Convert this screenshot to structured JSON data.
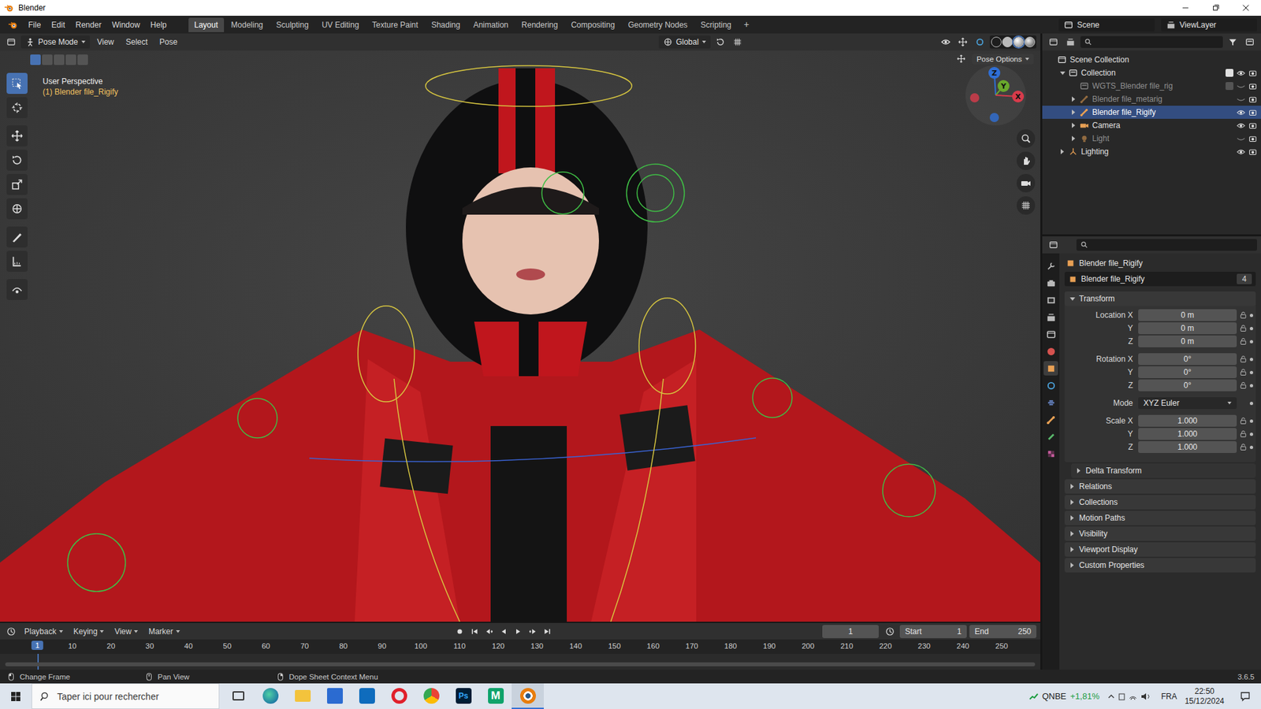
{
  "window": {
    "title": "Blender"
  },
  "menu": [
    "File",
    "Edit",
    "Render",
    "Window",
    "Help"
  ],
  "workspaces": [
    {
      "label": "Layout",
      "selected": true
    },
    {
      "label": "Modeling",
      "selected": false
    },
    {
      "label": "Sculpting",
      "selected": false
    },
    {
      "label": "UV Editing",
      "selected": false
    },
    {
      "label": "Texture Paint",
      "selected": false
    },
    {
      "label": "Shading",
      "selected": false
    },
    {
      "label": "Animation",
      "selected": false
    },
    {
      "label": "Rendering",
      "selected": false
    },
    {
      "label": "Compositing",
      "selected": false
    },
    {
      "label": "Geometry Nodes",
      "selected": false
    },
    {
      "label": "Scripting",
      "selected": false
    }
  ],
  "add_workspace": "+",
  "scene": "Scene",
  "view_layer": "ViewLayer",
  "viewport": {
    "mode": "Pose Mode",
    "menus": [
      "View",
      "Select",
      "Pose"
    ],
    "orientation": "Global",
    "pose_options": "Pose Options",
    "view_name": "User Perspective",
    "active_object": "(1) Blender file_Rigify",
    "select_modes": [
      {
        "selected": true
      },
      {
        "selected": false
      },
      {
        "selected": false
      },
      {
        "selected": false
      },
      {
        "selected": false
      }
    ],
    "tools": [
      {
        "kind": "select-box",
        "selected": true
      },
      {
        "kind": "cursor",
        "selected": false
      },
      {
        "kind": "move",
        "selected": false
      },
      {
        "kind": "rotate",
        "selected": false
      },
      {
        "kind": "scale",
        "selected": false
      },
      {
        "kind": "transform",
        "selected": false
      },
      {
        "kind": "annotate",
        "selected": false
      },
      {
        "kind": "measure",
        "selected": false
      },
      {
        "kind": "roll",
        "selected": false
      }
    ],
    "axes": [
      {
        "label": "Z",
        "color": "#2f6fd6"
      },
      {
        "label": "Y",
        "color": "#6aa82c"
      },
      {
        "label": "X",
        "color": "#d83b4b"
      }
    ],
    "nav": [
      {
        "kind": "zoom"
      },
      {
        "kind": "pan"
      },
      {
        "kind": "camera"
      },
      {
        "kind": "grid"
      }
    ]
  },
  "outliner": {
    "items": [
      {
        "label": "Scene Collection",
        "kind": "scene",
        "depth": 0,
        "expander": "none",
        "selected": false,
        "greyed": false,
        "has_checkbox": false,
        "checked": false,
        "visible": true,
        "has_eye": false
      },
      {
        "label": "Collection",
        "kind": "collection",
        "depth": 1,
        "expander": "open",
        "selected": false,
        "greyed": false,
        "has_checkbox": true,
        "checked": true,
        "visible": true,
        "has_eye": true
      },
      {
        "label": "WGTS_Blender file_rig",
        "kind": "collection",
        "depth": 2,
        "expander": "none",
        "selected": false,
        "greyed": true,
        "has_checkbox": true,
        "checked": false,
        "visible": false,
        "has_eye": true
      },
      {
        "label": "Blender file_metarig",
        "kind": "armature",
        "depth": 2,
        "expander": "closed",
        "selected": false,
        "greyed": true,
        "has_checkbox": false,
        "checked": false,
        "visible": false,
        "has_eye": true
      },
      {
        "label": "Blender file_Rigify",
        "kind": "armature",
        "depth": 2,
        "expander": "closed",
        "selected": true,
        "greyed": false,
        "has_checkbox": false,
        "checked": false,
        "visible": true,
        "has_eye": true
      },
      {
        "label": "Camera",
        "kind": "camera",
        "depth": 2,
        "expander": "closed",
        "selected": false,
        "greyed": false,
        "has_checkbox": false,
        "checked": false,
        "visible": true,
        "has_eye": true
      },
      {
        "label": "Light",
        "kind": "light",
        "depth": 2,
        "expander": "closed",
        "selected": false,
        "greyed": true,
        "has_checkbox": false,
        "checked": false,
        "visible": false,
        "has_eye": true
      },
      {
        "label": "Lighting",
        "kind": "lighting",
        "depth": 1,
        "expander": "closed",
        "selected": false,
        "greyed": false,
        "has_checkbox": false,
        "checked": false,
        "visible": true,
        "has_eye": true
      }
    ]
  },
  "properties": {
    "object": "Blender file_Rigify",
    "datablock": "Blender file_Rigify",
    "users": "4",
    "tabs": [
      {
        "kind": "tool",
        "selected": false
      },
      {
        "kind": "render",
        "selected": false
      },
      {
        "kind": "output",
        "selected": false
      },
      {
        "kind": "view-layer",
        "selected": false
      },
      {
        "kind": "scene",
        "selected": false
      },
      {
        "kind": "world",
        "selected": false
      },
      {
        "kind": "object",
        "selected": true
      },
      {
        "kind": "physics",
        "selected": false
      },
      {
        "kind": "constraints",
        "selected": false
      },
      {
        "kind": "armature",
        "selected": false
      },
      {
        "kind": "bone",
        "selected": false
      },
      {
        "kind": "texture",
        "selected": false
      }
    ],
    "transform": {
      "title": "Transform",
      "expanded": true,
      "groups": [
        {
          "rows": [
            {
              "label": "Location X",
              "value": "0 m",
              "kind": "number",
              "locked": false
            },
            {
              "label": "Y",
              "value": "0 m",
              "kind": "number",
              "locked": false
            },
            {
              "label": "Z",
              "value": "0 m",
              "kind": "number",
              "locked": false
            }
          ]
        },
        {
          "rows": [
            {
              "label": "Rotation X",
              "value": "0°",
              "kind": "number",
              "locked": false
            },
            {
              "label": "Y",
              "value": "0°",
              "kind": "number",
              "locked": false
            },
            {
              "label": "Z",
              "value": "0°",
              "kind": "number",
              "locked": false
            }
          ]
        },
        {
          "rows": [
            {
              "label": "Mode",
              "value": "XYZ Euler",
              "kind": "dropdown",
              "locked": false
            }
          ]
        },
        {
          "rows": [
            {
              "label": "Scale X",
              "value": "1.000",
              "kind": "number",
              "locked": false
            },
            {
              "label": "Y",
              "value": "1.000",
              "kind": "number",
              "locked": false
            },
            {
              "label": "Z",
              "value": "1.000",
              "kind": "number",
              "locked": false
            }
          ]
        }
      ]
    },
    "panels": [
      {
        "label": "Delta Transform",
        "expanded": false,
        "sub": true
      },
      {
        "label": "Relations",
        "expanded": false,
        "sub": false
      },
      {
        "label": "Collections",
        "expanded": false,
        "sub": false
      },
      {
        "label": "Motion Paths",
        "expanded": false,
        "sub": false
      },
      {
        "label": "Visibility",
        "expanded": false,
        "sub": false
      },
      {
        "label": "Viewport Display",
        "expanded": false,
        "sub": false
      },
      {
        "label": "Custom Properties",
        "expanded": false,
        "sub": false
      }
    ]
  },
  "timeline": {
    "menus": [
      "Playback",
      "Keying",
      "View",
      "Marker"
    ],
    "current_frame": "1",
    "start_label": "Start",
    "start": "1",
    "end_label": "End",
    "end": "250",
    "auto_key": false,
    "ruler": [
      "1",
      "10",
      "20",
      "30",
      "40",
      "50",
      "60",
      "70",
      "80",
      "90",
      "100",
      "110",
      "120",
      "130",
      "140",
      "150",
      "160",
      "170",
      "180",
      "190",
      "200",
      "210",
      "220",
      "230",
      "240",
      "250"
    ]
  },
  "status_bar": {
    "hints": [
      {
        "label": "Change Frame",
        "kind": "mouse-left"
      },
      {
        "label": "Pan View",
        "kind": "mouse-middle"
      },
      {
        "label": "Dope Sheet Context Menu",
        "kind": "mouse-right"
      }
    ],
    "version": "3.6.5"
  },
  "taskbar": {
    "search": "Taper ici pour rechercher",
    "apps": [
      {
        "kind": "task-view",
        "glyph": "",
        "running": false
      },
      {
        "kind": "edge",
        "glyph": "",
        "running": false
      },
      {
        "kind": "explorer",
        "glyph": "",
        "running": false
      },
      {
        "kind": "store",
        "glyph": "",
        "running": false
      },
      {
        "kind": "outlook",
        "glyph": "",
        "running": false
      },
      {
        "kind": "opera",
        "glyph": "",
        "running": false
      },
      {
        "kind": "chrome",
        "glyph": "",
        "running": false
      },
      {
        "kind": "photoshop",
        "glyph": "Ps",
        "running": false
      },
      {
        "kind": "m-app",
        "glyph": "M",
        "running": false
      },
      {
        "kind": "blender",
        "glyph": "",
        "running": true
      }
    ],
    "stock_symbol": "QNBE",
    "stock_change": "+1,81%",
    "language": "FRA",
    "time": "22:50",
    "date": "15/12/2024"
  }
}
